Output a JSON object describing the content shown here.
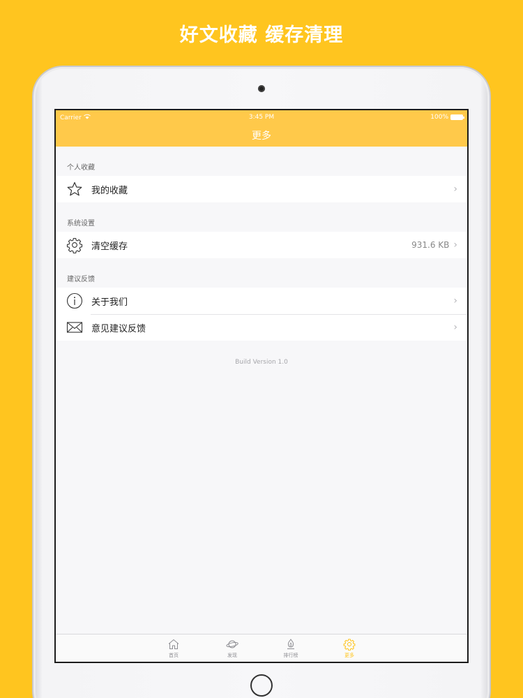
{
  "promo": {
    "title": "好文收藏 缓存清理"
  },
  "status_bar": {
    "carrier": "Carrier",
    "time": "3:45 PM",
    "battery": "100%"
  },
  "nav": {
    "title": "更多"
  },
  "sections": [
    {
      "header": "个人收藏",
      "items": [
        {
          "label": "我的收藏",
          "icon": "star-icon",
          "detail": ""
        }
      ]
    },
    {
      "header": "系统设置",
      "items": [
        {
          "label": "清空缓存",
          "icon": "gear-icon",
          "detail": "931.6 KB"
        }
      ]
    },
    {
      "header": "建议反馈",
      "items": [
        {
          "label": "关于我们",
          "icon": "info-icon",
          "detail": ""
        },
        {
          "label": "意见建议反馈",
          "icon": "mail-icon",
          "detail": ""
        }
      ]
    }
  ],
  "footer": {
    "version": "Build Version 1.0"
  },
  "tab_bar": {
    "tabs": [
      {
        "label": "首页",
        "icon": "home-icon",
        "active": false
      },
      {
        "label": "发现",
        "icon": "planet-icon",
        "active": false
      },
      {
        "label": "排行榜",
        "icon": "trophy-icon",
        "active": false
      },
      {
        "label": "更多",
        "icon": "gear-icon",
        "active": true
      }
    ]
  },
  "colors": {
    "background": "#FFC51F",
    "nav": "#FFC94A",
    "active_tab": "#FFC51F"
  }
}
